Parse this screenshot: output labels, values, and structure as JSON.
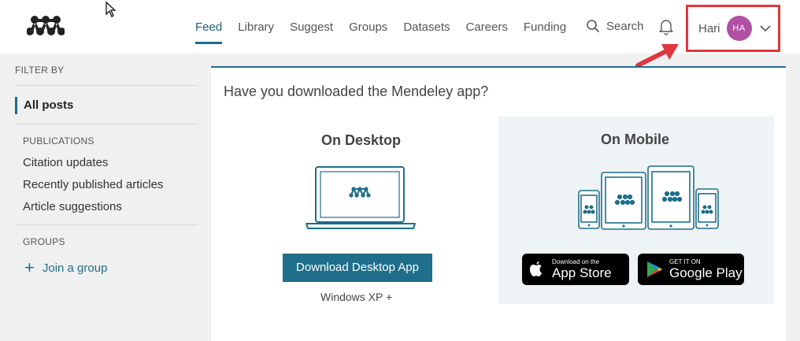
{
  "header": {
    "nav": [
      "Feed",
      "Library",
      "Suggest",
      "Groups",
      "Datasets",
      "Careers",
      "Funding"
    ],
    "search_label": "Search",
    "user_name": "Hari",
    "avatar_initials": "HA"
  },
  "sidebar": {
    "filter_title": "FILTER BY",
    "all_posts": "All posts",
    "publications_title": "PUBLICATIONS",
    "publications": [
      "Citation updates",
      "Recently published articles",
      "Article suggestions"
    ],
    "groups_title": "GROUPS",
    "join_group": "Join a group"
  },
  "main": {
    "title": "Have you downloaded the Mendeley app?",
    "desktop_title": "On Desktop",
    "download_button": "Download Desktop App",
    "desktop_requirement": "Windows XP +",
    "mobile_title": "On Mobile",
    "app_store_small": "Download on the",
    "app_store_big": "App Store",
    "google_play_small": "GET IT ON",
    "google_play_big": "Google Play"
  },
  "colors": {
    "accent": "#1f6e8a",
    "avatar": "#b04fa4",
    "highlight": "#e0363d"
  },
  "icons": [
    "mendeley-logo-icon",
    "cursor-icon",
    "search-icon",
    "bell-icon",
    "chevron-down-icon",
    "arrow-icon",
    "plus-icon",
    "laptop-icon",
    "devices-icon",
    "apple-icon",
    "google-play-icon"
  ]
}
